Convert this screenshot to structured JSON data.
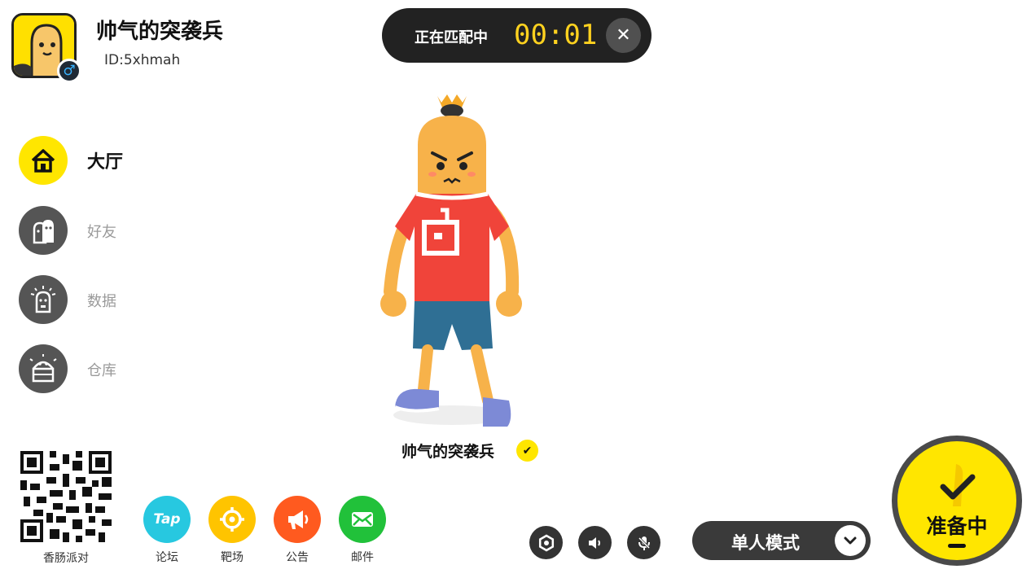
{
  "player": {
    "name": "帅气的突袭兵",
    "id_text": "ID:5xhmah",
    "gender_symbol": "♂"
  },
  "matching": {
    "label": "正在匹配中",
    "timer": "00:01",
    "close_symbol": "✕"
  },
  "sidebar": {
    "items": [
      {
        "label": "大厅",
        "icon": "home-icon",
        "active": true
      },
      {
        "label": "好友",
        "icon": "friends-icon",
        "active": false
      },
      {
        "label": "数据",
        "icon": "stats-icon",
        "active": false
      },
      {
        "label": "仓库",
        "icon": "warehouse-icon",
        "active": false
      }
    ]
  },
  "character": {
    "name": "帅气的突袭兵",
    "check_symbol": "✔"
  },
  "bottom_left": {
    "qr_label": "香肠派对",
    "apps": [
      {
        "label": "论坛",
        "icon": "tap-icon",
        "icon_text": "Tap",
        "color": "#27c8e0"
      },
      {
        "label": "靶场",
        "icon": "target-icon",
        "color": "#ffc400"
      },
      {
        "label": "公告",
        "icon": "megaphone-icon",
        "color": "#ff5a1f"
      },
      {
        "label": "邮件",
        "icon": "mail-icon",
        "color": "#21c13a"
      }
    ]
  },
  "controls": {
    "icons": [
      "settings-icon",
      "speaker-icon",
      "microphone-icon"
    ]
  },
  "mode": {
    "label": "单人模式"
  },
  "ready": {
    "label": "准备中"
  },
  "colors": {
    "accent": "#ffe600",
    "dark": "#222222",
    "timer": "#ffd21f"
  }
}
